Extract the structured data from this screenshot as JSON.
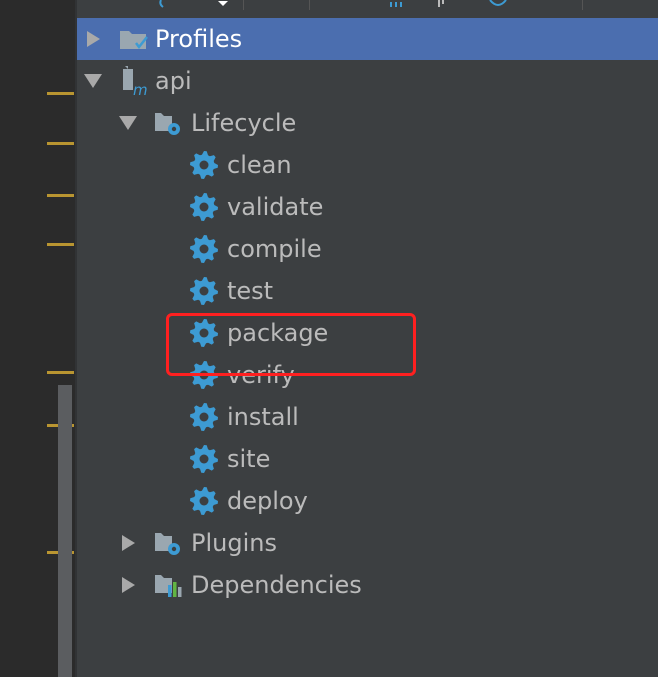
{
  "tree": {
    "profiles": {
      "label": "Profiles",
      "icon": "profiles-folder-icon"
    },
    "project": {
      "label": "api",
      "icon": "maven-module-icon"
    },
    "lifecycle": {
      "label": "Lifecycle",
      "icon": "lifecycle-folder-icon",
      "phases": [
        {
          "label": "clean",
          "icon": "gear-icon"
        },
        {
          "label": "validate",
          "icon": "gear-icon"
        },
        {
          "label": "compile",
          "icon": "gear-icon"
        },
        {
          "label": "test",
          "icon": "gear-icon"
        },
        {
          "label": "package",
          "icon": "gear-icon"
        },
        {
          "label": "verify",
          "icon": "gear-icon"
        },
        {
          "label": "install",
          "icon": "gear-icon"
        },
        {
          "label": "site",
          "icon": "gear-icon"
        },
        {
          "label": "deploy",
          "icon": "gear-icon"
        }
      ]
    },
    "plugins": {
      "label": "Plugins",
      "icon": "plugins-folder-icon"
    },
    "dependencies": {
      "label": "Dependencies",
      "icon": "dependencies-folder-icon"
    }
  },
  "colors": {
    "selection": "#4b6eaf",
    "gear": "#3d9bd3",
    "annotation": "#ff2020",
    "gutter_marker": "#b99531"
  }
}
